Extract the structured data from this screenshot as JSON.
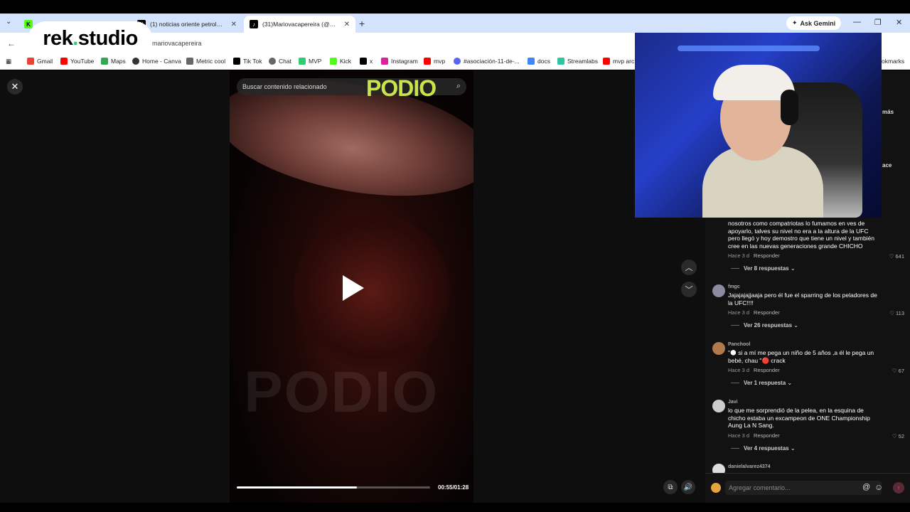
{
  "tabs": [
    {
      "label": "",
      "favicon": "kick-icon",
      "color": "#53fc18"
    },
    {
      "label": "(1) noticias oriente petrolero -",
      "favicon": "x-icon",
      "color": "#000000"
    },
    {
      "label": "(31)Mariovacapereira (@mario",
      "favicon": "tiktok-icon",
      "color": "#000000"
    }
  ],
  "browser": {
    "ask_gemini": "Ask Gemini",
    "url": "mariovacapereira",
    "bookmarks": [
      "Gmail",
      "YouTube",
      "Maps",
      "Home - Canva",
      "Metric cool",
      "Tik Tok",
      "Chat",
      "MVP",
      "Kick",
      "x",
      "Instagram",
      "mvp",
      "#asociación-11-de-...",
      "docs",
      "Streamlabs",
      "mvp arc",
      "okmarks"
    ]
  },
  "overlay": {
    "logo_pre": "rek",
    "logo_dot": ".",
    "logo_post": "studio"
  },
  "video": {
    "search_placeholder": "Buscar contenido relacionado",
    "brand_top": "PODIO",
    "brand_watermark": "PODIO",
    "time": "00:55/01:28",
    "progress": 0.62
  },
  "side_fragments": {
    "more": "más",
    "ace": "ace"
  },
  "comments": [
    {
      "user": "",
      "text": "nosotros como compatriotas lo fumamos en ves de apoyarlo, talves su nivel no era a la altura de la UFC pero llegó y hoy demostro que tiene un nivel y también cree en las nuevas generaciones grande CHICHO",
      "meta": "Hace 3 d",
      "reply": "Responder",
      "likes": "641",
      "more": "Ver 8 respuestas"
    },
    {
      "user": "fmgc",
      "text": "Jajajajajjaaja pero él fue el sparring de los peladores de la UFC!!!!",
      "meta": "Hace 3 d",
      "reply": "Responder",
      "likes": "113",
      "more": "Ver 26 respuestas"
    },
    {
      "user": "Panchool",
      "text": "\"🌑 si a mí me pega un niño de 5 años ,a él le pega un bebé, chau \"🔴 crack",
      "meta": "Hace 3 d",
      "reply": "Responder",
      "likes": "67",
      "more": "Ver 1 respuesta"
    },
    {
      "user": "Javi",
      "text": "lo que me sorprendió de la pelea, en la esquina de chicho estaba un excampeon de ONE Championship Aung La N Sang.",
      "meta": "Hace 3 d",
      "reply": "Responder",
      "likes": "52",
      "more": "Ver 4 respuestas"
    },
    {
      "user": "danielalvarez4374",
      "text": "",
      "meta": "",
      "reply": "",
      "likes": "",
      "more": ""
    }
  ],
  "comment_input": {
    "placeholder": "Agregar comentario..."
  }
}
